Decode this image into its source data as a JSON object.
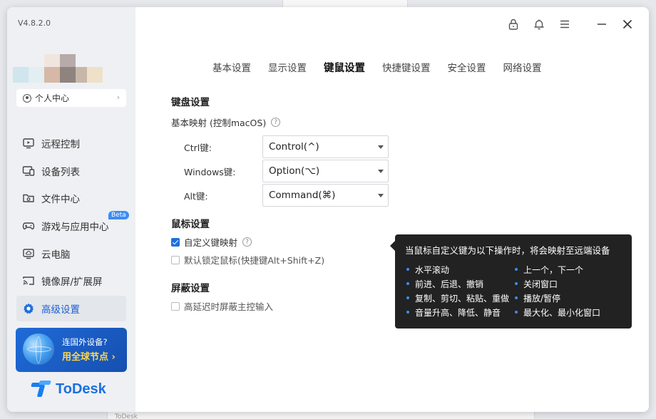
{
  "app": {
    "version": "V4.8.2.0",
    "profile_label": "个人中心",
    "brand_name": "ToDesk",
    "accent_color": "#1d6fe0"
  },
  "nav": {
    "items": [
      {
        "label": "远程控制",
        "icon": "monitor-play-icon"
      },
      {
        "label": "设备列表",
        "icon": "devices-icon"
      },
      {
        "label": "文件中心",
        "icon": "folder-icon"
      },
      {
        "label": "游戏与应用中心",
        "icon": "gamepad-icon",
        "badge": "Beta"
      },
      {
        "label": "云电脑",
        "icon": "cloud-pc-icon"
      },
      {
        "label": "镜像屏/扩展屏",
        "icon": "cast-screen-icon"
      },
      {
        "label": "高级设置",
        "icon": "gear-icon",
        "active": true
      }
    ]
  },
  "promo": {
    "line1": "连国外设备?",
    "line2": "用全球节点 ›"
  },
  "tabs": [
    "基本设置",
    "显示设置",
    "键鼠设置",
    "快捷键设置",
    "安全设置",
    "网络设置"
  ],
  "active_tab": "键鼠设置",
  "keyboard": {
    "title": "键盘设置",
    "basic_mapping_label": "基本映射 (控制macOS)",
    "rows": [
      {
        "key": "Ctrl键:",
        "value": "Control(^)"
      },
      {
        "key": "Windows键:",
        "value": "Option(⌥)"
      },
      {
        "key": "Alt键:",
        "value": "Command(⌘)"
      }
    ]
  },
  "mouse": {
    "title": "鼠标设置",
    "custom_mapping_label": "自定义键映射",
    "custom_mapping_checked": true,
    "lock_mouse_label": "默认锁定鼠标(快捷键Alt+Shift+Z)",
    "lock_mouse_checked": false
  },
  "mask": {
    "title": "屏蔽设置",
    "high_latency_label": "高延迟时屏蔽主控输入",
    "high_latency_checked": false
  },
  "tooltip": {
    "title": "当鼠标自定义键为以下操作时，将会映射至远端设备",
    "left": [
      "水平滚动",
      "前进、后退、撤销",
      "复制、剪切、粘贴、重做",
      "音量升高、降低、静音"
    ],
    "right": [
      "上一个，下一个",
      "关闭窗口",
      "播放/暂停",
      "最大化、最小化窗口"
    ]
  },
  "bg_fragments": {
    "bottom_text": "ToDesk"
  }
}
